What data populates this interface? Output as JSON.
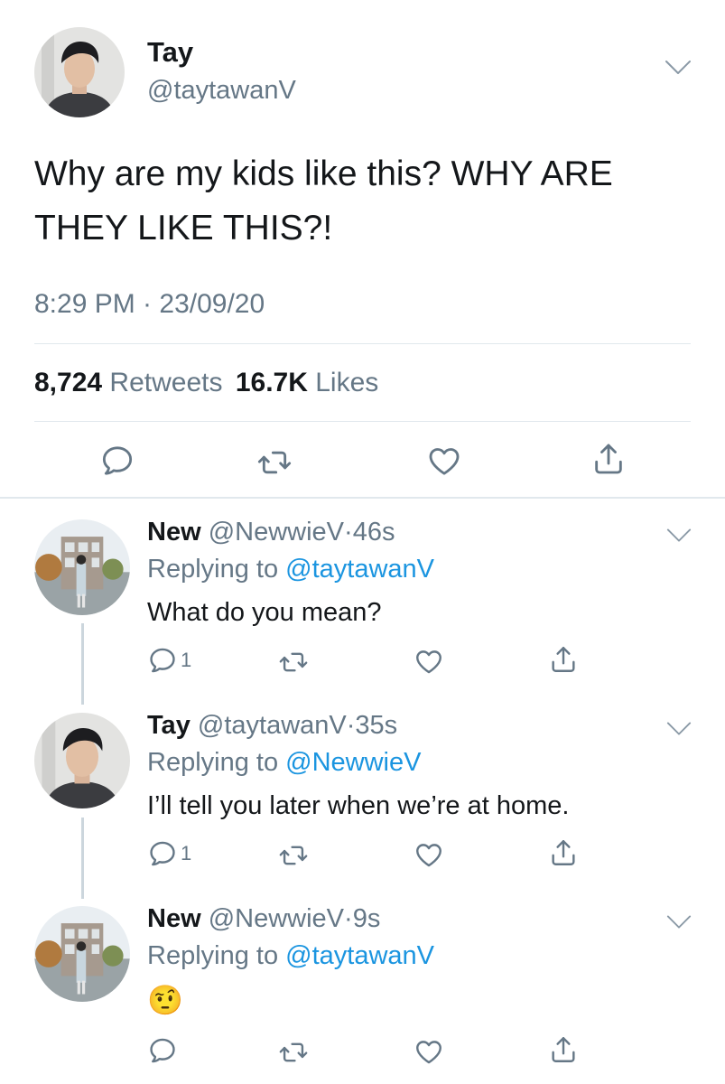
{
  "tweet": {
    "name": "Tay",
    "handle": "@taytawanV",
    "text": "Why are my kids like this? WHY ARE THEY LIKE THIS?!",
    "timestamp": "8:29 PM · 23/09/20",
    "retweets_count": "8,724",
    "retweets_label": "Retweets",
    "likes_count": "16.7K",
    "likes_label": "Likes"
  },
  "replies": [
    {
      "name": "New",
      "handle": "@NewwieV",
      "age": "46s",
      "replying_label": "Replying to",
      "replying_to": "@taytawanV",
      "text": "What do you mean?",
      "reply_count": "1"
    },
    {
      "name": "Tay",
      "handle": "@taytawanV",
      "age": "35s",
      "replying_label": "Replying to",
      "replying_to": "@NewwieV",
      "text": "I’ll tell you later when we’re at home.",
      "reply_count": "1"
    },
    {
      "name": "New",
      "handle": "@NewwieV",
      "age": "9s",
      "replying_label": "Replying to",
      "replying_to": "@taytawanV",
      "text": "🤨",
      "reply_count": ""
    }
  ],
  "separator": "·",
  "icons": [
    "reply-icon",
    "retweet-icon",
    "like-icon",
    "share-icon",
    "chevron-down-icon"
  ],
  "colors": {
    "link": "#1b95e0",
    "muted": "#657786",
    "divider": "#e1e8ed",
    "text": "#14171a"
  }
}
